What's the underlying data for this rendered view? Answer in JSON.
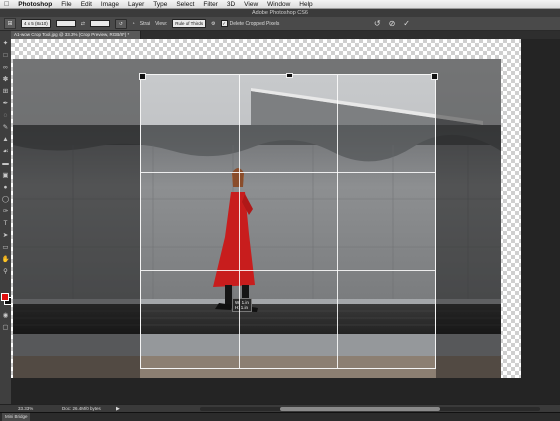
{
  "menubar": {
    "app_name": "Photoshop",
    "items": [
      "File",
      "Edit",
      "Image",
      "Layer",
      "Type",
      "Select",
      "Filter",
      "3D",
      "View",
      "Window",
      "Help"
    ]
  },
  "window_title": "Adobe Photoshop CS6",
  "options_bar": {
    "ratio_select": "4 x 5 (8x10)",
    "straighten_label": "Strai",
    "view_label": "View:",
    "view_select": "Rule of Thirds",
    "delete_cropped_label": "Delete Cropped Pixels",
    "delete_cropped_checked": "✓"
  },
  "document_tab": "A1-wow Crop Tool.jpg @ 33.3% (Crop Preview, RGB/8*) *",
  "crop_tooltip": {
    "line1": "W: 1.in",
    "line2": "H: 1.in"
  },
  "status_bar": {
    "zoom": "33.33%",
    "doc_info": "Doc: 26.4M/0 bytes"
  },
  "mini_bridge": "Mini Bridge",
  "colors": {
    "foreground": "#e01010",
    "background": "#111111",
    "dress": "#c81d1d"
  }
}
